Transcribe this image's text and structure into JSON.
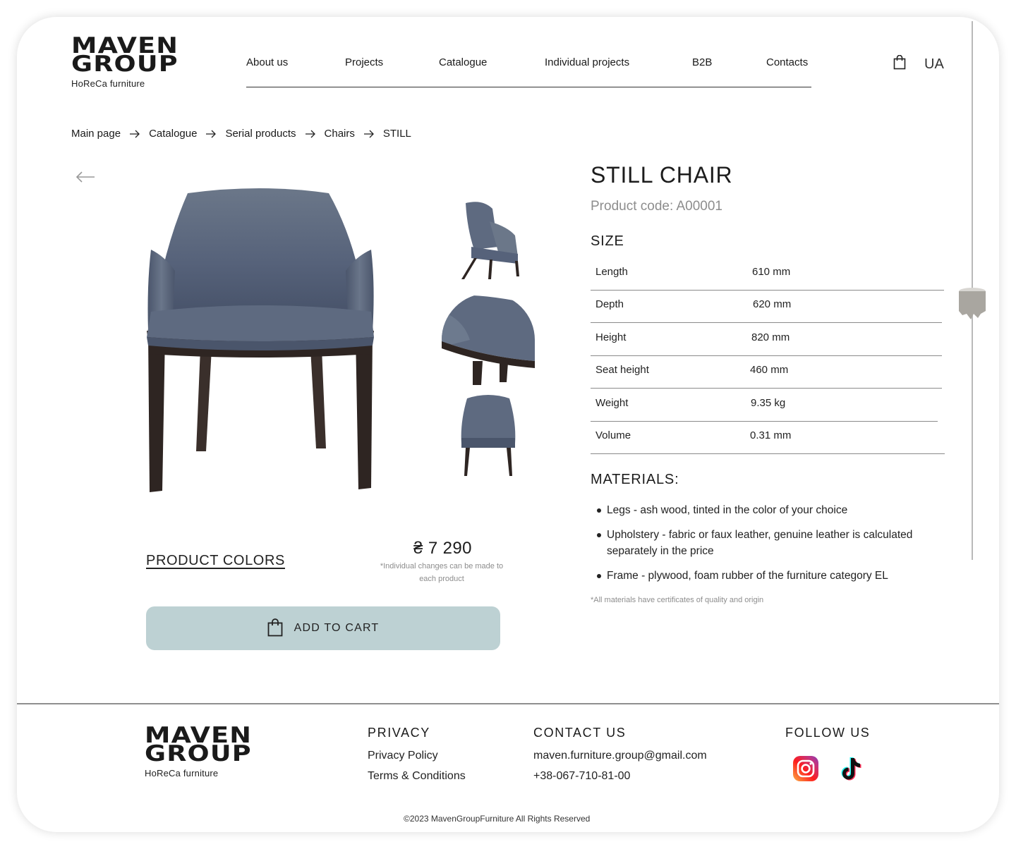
{
  "brand": {
    "line1": "MAVEN",
    "line2": "GROUP",
    "tagline": "HoReCa furniture"
  },
  "nav": {
    "items": [
      "About us",
      "Projects",
      "Catalogue",
      "Individual projects",
      "B2B",
      "Contacts"
    ],
    "cart_icon": "shopping-bag-icon",
    "language": "UA"
  },
  "breadcrumb": {
    "items": [
      "Main page",
      "Catalogue",
      "Serial products",
      "Chairs",
      "STILL"
    ]
  },
  "gallery": {
    "back_icon": "arrow-left-icon",
    "thumbnails": [
      "chair-side-view",
      "chair-seat-detail",
      "chair-back-view"
    ]
  },
  "product": {
    "title": "STILL CHAIR",
    "code": "Product code: A00001",
    "size_heading": "SIZE",
    "specs": [
      {
        "label": "Length",
        "value": "610 mm"
      },
      {
        "label": "Depth",
        "value": "620 mm"
      },
      {
        "label": "Height",
        "value": "820 mm"
      },
      {
        "label": "Seat height",
        "value": "460 mm"
      },
      {
        "label": "Weight",
        "value": "9.35 kg"
      },
      {
        "label": "Volume",
        "value": "0.31 mm"
      }
    ],
    "materials_heading": "MATERIALS:",
    "materials": [
      "Legs - ash wood, tinted in the color of your choice",
      "Upholstery - fabric or faux leather, genuine leather is calculated separately in the price",
      "Frame - plywood, foam rubber of the furniture category EL"
    ],
    "materials_note": "*All materials have certificates of quality and origin",
    "colors_link": "PRODUCT COLORS",
    "price": "₴ 7 290",
    "price_note": "*Individual changes can be made to each product",
    "add_to_cart": "ADD TO CART"
  },
  "footer": {
    "privacy_heading": "PRIVACY",
    "privacy_links": [
      "Privacy Policy",
      "Terms & Conditions"
    ],
    "contact_heading": "CONTACT US",
    "email": "maven.furniture.group@gmail.com",
    "phone": "+38-067-710-81-00",
    "follow_heading": "FOLLOW US",
    "social_icons": [
      "instagram-icon",
      "tiktok-icon"
    ],
    "copyright": "©2023 MavenGroupFurniture All Rights Reserved"
  },
  "colors": {
    "button_bg": "#bdd1d3",
    "chair_fabric": "#5a6678",
    "chair_wood": "#2e2522",
    "muted_text": "#8d8d8d"
  }
}
